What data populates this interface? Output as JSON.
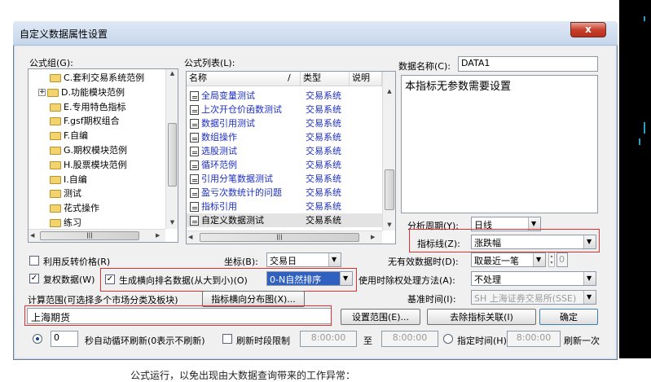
{
  "dialog": {
    "title": "自定义数据属性设置",
    "close_glyph": "x"
  },
  "formula_group": {
    "label": "公式组(G):",
    "items": [
      {
        "label": "C.套利交易系统范例",
        "expander": ""
      },
      {
        "label": "D.功能模块范例",
        "expander": "+"
      },
      {
        "label": "E.专用特色指标",
        "expander": ""
      },
      {
        "label": "F.gsf期权组合",
        "expander": ""
      },
      {
        "label": "F.自编",
        "expander": ""
      },
      {
        "label": "G.期权模块范例",
        "expander": ""
      },
      {
        "label": "H.股票模块范例",
        "expander": ""
      },
      {
        "label": "I.自编",
        "expander": ""
      },
      {
        "label": "测试",
        "expander": ""
      },
      {
        "label": "花式操作",
        "expander": ""
      },
      {
        "label": "练习",
        "expander": ""
      }
    ]
  },
  "formula_list": {
    "label": "公式列表(L):",
    "columns": [
      "名称",
      "/",
      "类型",
      "说明"
    ],
    "rows": [
      {
        "name": "全局变量测试",
        "type": "交易系统"
      },
      {
        "name": "上次开仓价函数测试",
        "type": "交易系统"
      },
      {
        "name": "数据引用测试",
        "type": "交易系统"
      },
      {
        "name": "数组操作",
        "type": "交易系统"
      },
      {
        "name": "选股测试",
        "type": "交易系统"
      },
      {
        "name": "循环范例",
        "type": "交易系统"
      },
      {
        "name": "引用分笔数据测试",
        "type": "交易系统"
      },
      {
        "name": "盈亏次数统计的问题",
        "type": "交易系统"
      },
      {
        "name": "指标引用",
        "type": "交易系统"
      },
      {
        "name": "自定义数据测试",
        "type": "交易系统"
      }
    ]
  },
  "data_name": {
    "label": "数据名称(C):",
    "value": "DATA1",
    "description": "本指标无参数需要设置"
  },
  "analysis": {
    "period_label": "分析周期(Y):",
    "period_value": "日线",
    "indicator_label": "指标线(Z):",
    "indicator_value": "涨跌幅"
  },
  "options": {
    "reverse_price_label": "利用反转价格(R)",
    "reverse_price_checked": false,
    "coord_label": "坐标(B):",
    "coord_value": "交易日",
    "no_data_label": "无有效数据时(D):",
    "no_data_value": "取最近一笔",
    "no_data_number": "0",
    "rights_label": "复权数据(W)",
    "rights_checked": true,
    "rank_label": "生成横向排名数据(从大到小)(O)",
    "rank_checked": true,
    "rank_value": "0-N自然排序",
    "time_rights_label": "使用时除权处理方法(A):",
    "time_rights_value": "不处理",
    "range_label": "计算范围(可选择多个市场分类及板块)",
    "dist_button": "指标横向分布图(X)...",
    "base_time_label": "基准时间(I):",
    "base_time_value": "SH 上海证券交易所(SSE)",
    "range_value": "上海期货",
    "set_range_button": "设置范围(E)...",
    "remove_link_button": "去除指标关联(I)",
    "ok_button": "确定"
  },
  "refresh": {
    "seconds_value": "0",
    "seconds_label": "秒自动循环刷新(0表示不刷新)",
    "time_limit_label": "刷新时段限制",
    "time_from": "8:00:00",
    "to_label": "至",
    "time_to": "8:00:00",
    "specified_time_label": "指定时间(H)",
    "specified_time_value": "8:00:00",
    "refresh_once_label": "刷新一次"
  },
  "background": {
    "bottom_text": "公式运行，以免出现由大数据查询带来的工作异常："
  },
  "colors": {
    "highlight_red": "#e03030",
    "selection_blue": "#3060c0",
    "link_blue": "#1c2ec0"
  }
}
